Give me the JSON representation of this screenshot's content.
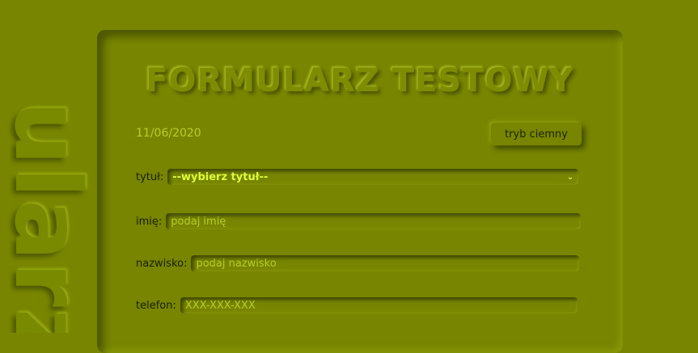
{
  "side_word": "ularz",
  "form": {
    "title": "FORMULARZ TESTOWY",
    "date": "11/06/2020",
    "dark_mode_button": "tryb ciemny",
    "title_field": {
      "label": "tytuł:",
      "value": "--wybierz tytuł--"
    },
    "name_field": {
      "label": "imię:",
      "placeholder": "podaj imię"
    },
    "surname_field": {
      "label": "nazwisko:",
      "placeholder": "podaj nazwisko"
    },
    "phone_field": {
      "label": "telefon:",
      "placeholder": "XXX-XXX-XXX"
    }
  },
  "colors": {
    "background": "#778500",
    "accent_text": "#dcfa3c",
    "label_text": "#1a1f00"
  },
  "icons": {
    "select_chevron": "chevron-down-icon"
  }
}
